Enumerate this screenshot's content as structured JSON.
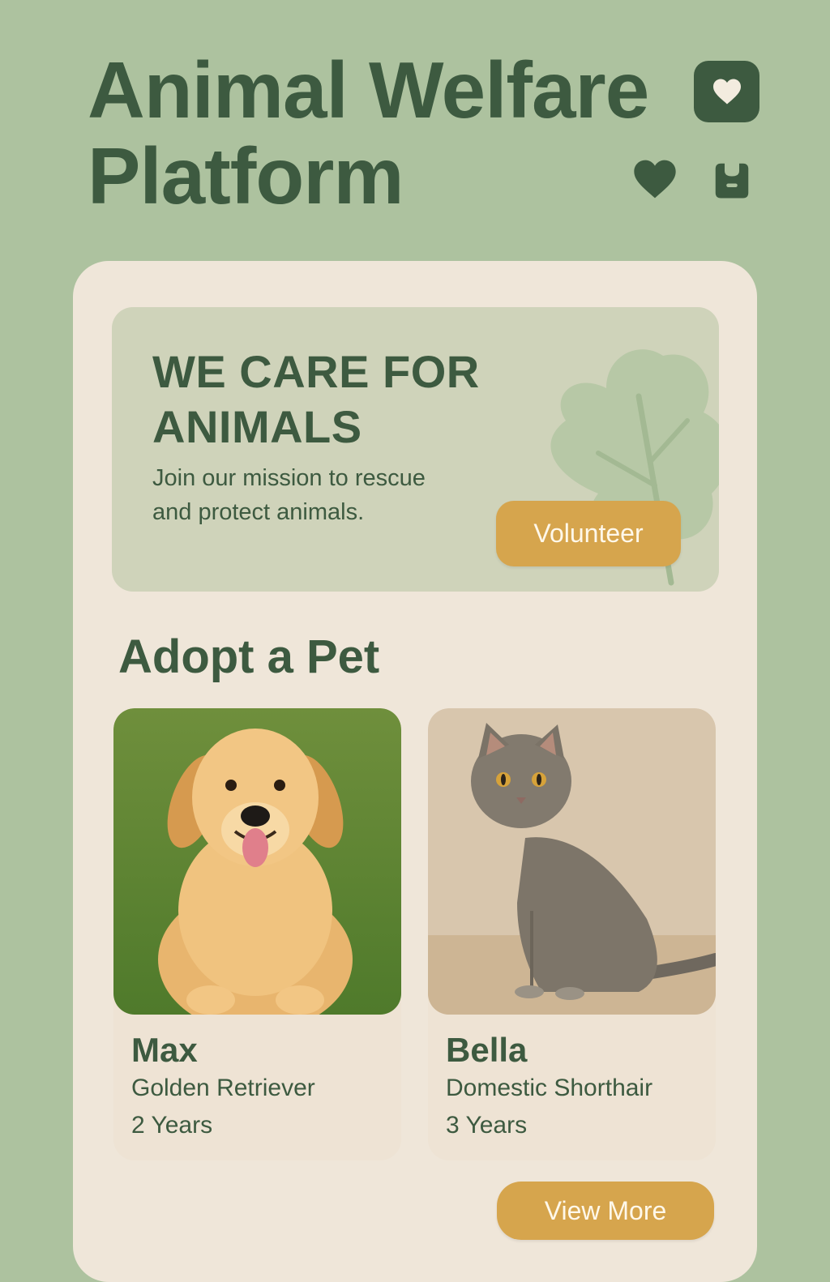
{
  "header": {
    "title_line1": "Animal Welfare",
    "title_line2": "Platform",
    "icons": [
      "heart-icon",
      "heart-icon",
      "bag-icon"
    ]
  },
  "hero": {
    "heading_line1": "WE CARE FOR",
    "heading_line2": "ANIMALS",
    "subtitle_line1": "Join our mission to rescue",
    "subtitle_line2": "and protect animals.",
    "button_label": "Volunteer"
  },
  "adopt": {
    "section_title": "Adopt a Pet",
    "pets": [
      {
        "name": "Max",
        "breed": "Golden Retriever",
        "age": "2 Years"
      },
      {
        "name": "Bella",
        "breed": "Domestic Shorthair",
        "age": "3 Years"
      }
    ],
    "view_more_label": "View More"
  },
  "colors": {
    "background": "#adc29f",
    "panel": "#efe6d9",
    "hero": "#cfd3ba",
    "primary_text": "#3d5a40",
    "accent_button": "#d6a54d"
  }
}
